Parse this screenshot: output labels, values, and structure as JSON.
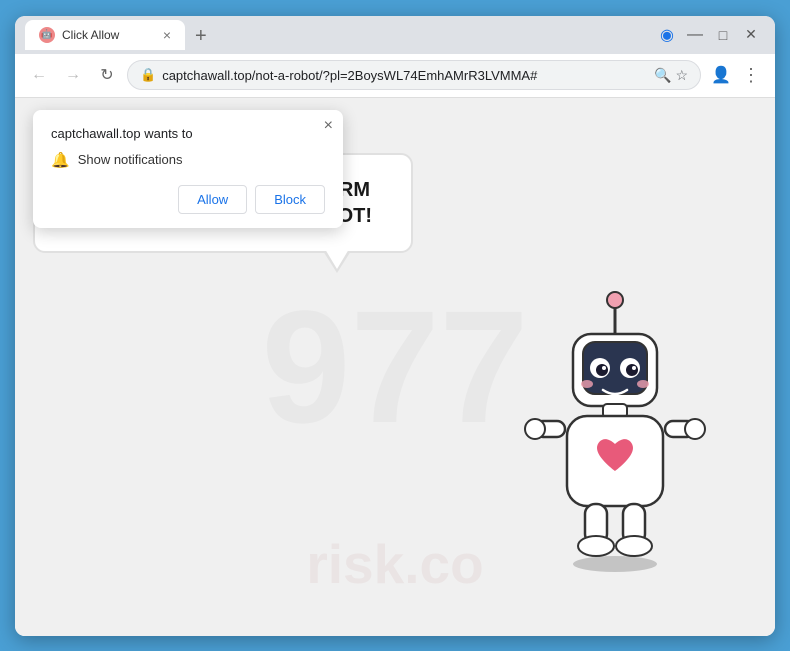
{
  "window": {
    "title": "Click Allow",
    "tab": {
      "favicon": "🤖",
      "title": "Click Allow",
      "close": "×"
    },
    "new_tab": "+"
  },
  "titlebar": {
    "minimize": "—",
    "maximize": "□",
    "close": "✕"
  },
  "toolbar": {
    "back": "←",
    "forward": "→",
    "reload": "↻",
    "lock": "🔒",
    "address": "captchawall.top/not-a-robot/?pl=2BoysWL74EmhAMrR3LVMMA#",
    "search_icon": "🔍",
    "star_icon": "☆",
    "account_icon": "👤",
    "menu_icon": "⋮",
    "vpn_icon": "🛡"
  },
  "notification_popup": {
    "title": "captchawall.top wants to",
    "close": "×",
    "notification_label": "Show notifications",
    "allow_button": "Allow",
    "block_button": "Block"
  },
  "page": {
    "bubble_text": "CLICK «ALLOW» TO CONFIRM THAT YOU ARE NOT A ROBOT!",
    "bg_number": "977",
    "bg_watermark": "risk.co"
  }
}
